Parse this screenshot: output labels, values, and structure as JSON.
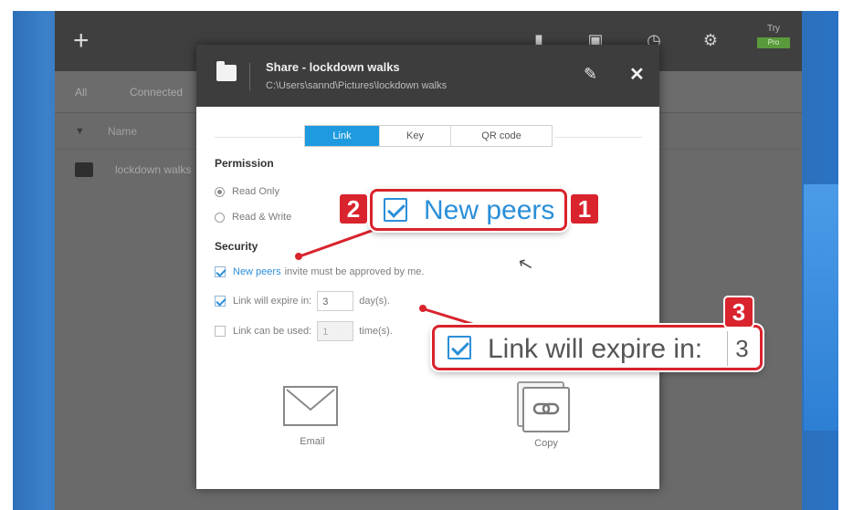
{
  "app": {
    "toolbar_plus": "+",
    "trial_label": "Try",
    "trial_badge": "Pro",
    "tabs": [
      "All",
      "Connected"
    ],
    "column_name": "Name",
    "file_name": "lockdown walks",
    "icons": [
      "plus-icon",
      "folder-icon",
      "monitor-icon",
      "clock-icon",
      "gear-icon"
    ]
  },
  "dialog": {
    "title": "Share - lockdown walks",
    "path": "C:\\Users\\sannd\\Pictures\\lockdown walks",
    "tabs": [
      {
        "label": "Link",
        "active": true
      },
      {
        "label": "Key",
        "active": false
      },
      {
        "label": "QR code",
        "active": false
      }
    ],
    "permission": {
      "label": "Permission",
      "read_only": "Read Only",
      "read_write": "Read & Write",
      "selected": "Read Only"
    },
    "security": {
      "label": "Security",
      "new_peers_link": "New peers",
      "new_peers_rest": "invite must be approved by me.",
      "new_peers_checked": true,
      "expire_label": "Link will expire in:",
      "expire_value": "3",
      "expire_unit": "day(s).",
      "expire_checked": true,
      "used_label": "Link can be used:",
      "used_value": "1",
      "used_unit": "time(s).",
      "used_checked": false
    },
    "share": {
      "email": "Email",
      "copy": "Copy"
    }
  },
  "callouts": {
    "one": {
      "number": "1",
      "text": "New peers"
    },
    "two": {
      "number": "2"
    },
    "three": {
      "number": "3",
      "text": "Link will expire in:",
      "value": "3"
    }
  },
  "colors": {
    "accent_blue": "#2b8fd8",
    "callout_red": "#d9232d",
    "dialog_header": "#3d3d3d"
  }
}
